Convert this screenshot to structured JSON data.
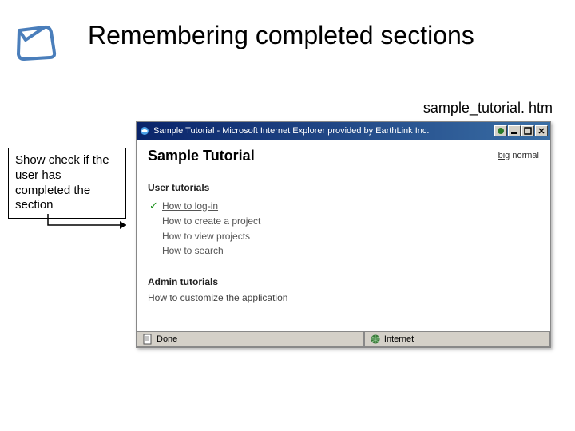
{
  "slide": {
    "title": "Remembering completed sections",
    "filename": "sample_tutorial. htm"
  },
  "callout": {
    "text": "Show check if the user has completed the section"
  },
  "browser": {
    "titlebar": "Sample Tutorial - Microsoft Internet Explorer provided by EarthLink Inc.",
    "page_title": "Sample Tutorial",
    "zoom_big": "big",
    "zoom_normal": "normal",
    "section1": "User tutorials",
    "items1": [
      {
        "checked": true,
        "label": "How to log-in"
      },
      {
        "checked": false,
        "label": "How to create a project"
      },
      {
        "checked": false,
        "label": "How to view projects"
      },
      {
        "checked": false,
        "label": "How to search"
      }
    ],
    "section2": "Admin tutorials",
    "admin_line": "How to customize the application",
    "status_left": "Done",
    "status_right": "Internet"
  }
}
